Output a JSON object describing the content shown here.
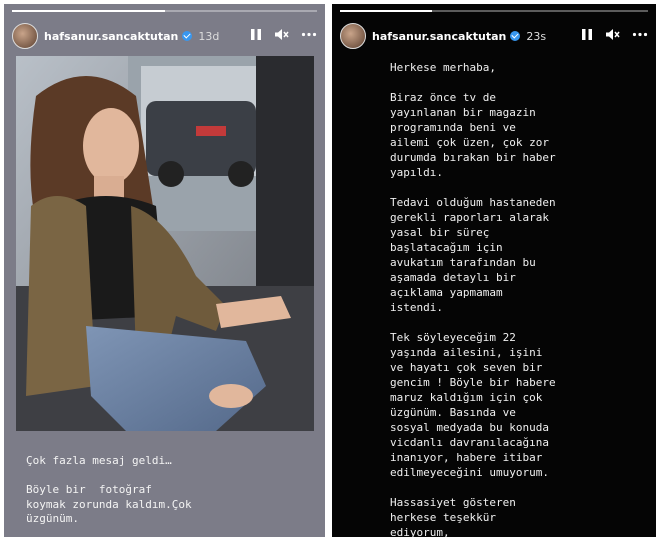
{
  "left_story": {
    "username": "hafsanur.sancaktutan",
    "time_ago": "13d",
    "progress_fraction": 0.5,
    "icons": {
      "pause": "pause-icon",
      "mute": "mute-icon",
      "more": "more-icon"
    },
    "caption": "Çok fazla mesaj geldi…\n\nBöyle bir  fotoğraf\nkoymak zorunda kaldım.Çok\nüzgünüm."
  },
  "right_story": {
    "username": "hafsanur.sancaktutan",
    "time_ago": "23s",
    "progress_fraction": 0.3,
    "icons": {
      "pause": "pause-icon",
      "mute": "mute-icon",
      "more": "more-icon"
    },
    "message": "Herkese merhaba,\n\nBiraz önce tv de\nyayınlanan bir magazin\nprogramında beni ve\nailemi çok üzen, çok zor\ndurumda bırakan bir haber\nyapıldı.\n\nTedavi olduğum hastaneden\ngerekli raporları alarak\nyasal bir süreç\nbaşlatacağım için\navukatım tarafından bu\naşamada detaylı bir\naçıklama yapmamam\nistendi.\n\nTek söyleyeceğim 22\nyaşında ailesini, işini\nve hayatı çok seven bir\ngencim ! Böyle bir habere\nmaruz kaldığım için çok\nüzgünüm. Basında ve\nsosyal medyada bu konuda\nvicdanlı davranılacağına\ninanıyor, habere itibar\nedilmeyeceğini umuyorum.\n\nHassasiyet gösteren\nherkese teşekkür\nediyorum,"
  },
  "colors": {
    "left_bg": "#7c7c88",
    "right_bg": "#050505",
    "verified": "#3897f0"
  }
}
